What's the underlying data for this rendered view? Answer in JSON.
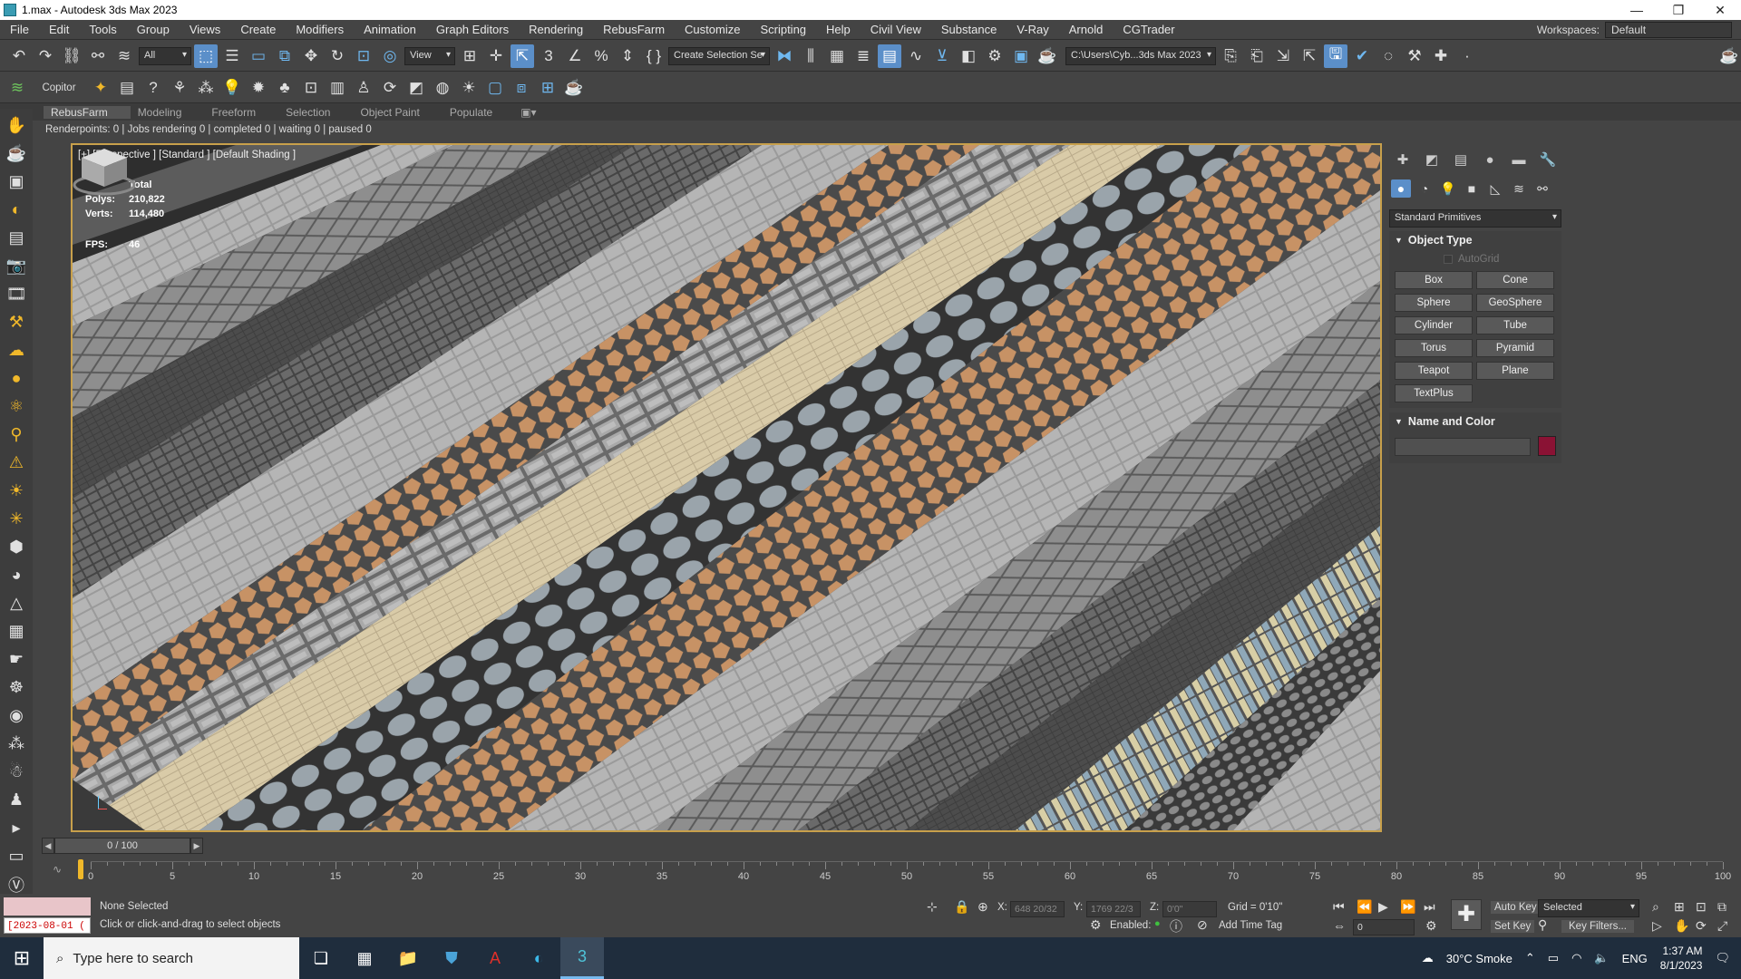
{
  "window": {
    "title": "1.max - Autodesk 3ds Max 2023",
    "minimize": "—",
    "maximize": "❐",
    "close": "✕"
  },
  "menu": {
    "items": [
      "File",
      "Edit",
      "Tools",
      "Group",
      "Views",
      "Create",
      "Modifiers",
      "Animation",
      "Graph Editors",
      "Rendering",
      "RebusFarm",
      "Customize",
      "Scripting",
      "Help",
      "Civil View",
      "Substance",
      "V-Ray",
      "Arnold",
      "CGTrader"
    ],
    "workspaces_label": "Workspaces:",
    "workspace_value": "Default"
  },
  "toolbar": {
    "filter_value": "All",
    "view_value": "View",
    "selection_set_value": "Create Selection Se",
    "project_path": "C:\\Users\\Cyb...3ds Max 2023"
  },
  "toolbar2": {
    "copitor_label": "Copitor"
  },
  "ribbon": {
    "tabs": [
      "RebusFarm",
      "Modeling",
      "Freeform",
      "Selection",
      "Object Paint",
      "Populate"
    ]
  },
  "renderpoints": "Renderpoints: 0 | Jobs rendering 0 | completed 0 | waiting 0 | paused 0",
  "viewport": {
    "label": "[+] [Perspective ] [Standard ] [Default Shading ]",
    "stats": {
      "header": "Total",
      "polys_label": "Polys:",
      "polys": "210,822",
      "verts_label": "Verts:",
      "verts": "114,480",
      "fps_label": "FPS:",
      "fps": "46"
    }
  },
  "command_panel": {
    "primitives_value": "Standard Primitives",
    "object_type_title": "Object Type",
    "autogrid_label": "AutoGrid",
    "buttons": [
      "Box",
      "Cone",
      "Sphere",
      "GeoSphere",
      "Cylinder",
      "Tube",
      "Torus",
      "Pyramid",
      "Teapot",
      "Plane",
      "TextPlus"
    ],
    "name_color_title": "Name and Color",
    "swatch_color": "#8a1234"
  },
  "timeline": {
    "slider": "0 / 100",
    "ticks": [
      "0",
      "5",
      "10",
      "15",
      "20",
      "25",
      "30",
      "35",
      "40",
      "45",
      "50",
      "55",
      "60",
      "65",
      "70",
      "75",
      "80",
      "85",
      "90",
      "95",
      "100"
    ]
  },
  "status": {
    "date": "[2023-08-01 (",
    "none_selected": "None Selected",
    "hint": "Click or click-and-drag to select objects",
    "x_label": "X:",
    "x_value": "648 20/32",
    "y_label": "Y:",
    "y_value": "1769 22/3",
    "z_label": "Z:",
    "z_value": "0'0\"",
    "grid": "Grid = 0'10\"",
    "enabled_label": "Enabled:",
    "add_time_tag": "Add Time Tag",
    "auto_key": "Auto Key",
    "auto_key_value": "Selected",
    "set_key": "Set Key",
    "key_filters": "Key Filters...",
    "frame": "0"
  },
  "taskbar": {
    "search_placeholder": "Type here to search",
    "weather": "30°C Smoke",
    "lang": "ENG",
    "time": "1:37 AM",
    "date": "8/1/2023"
  }
}
